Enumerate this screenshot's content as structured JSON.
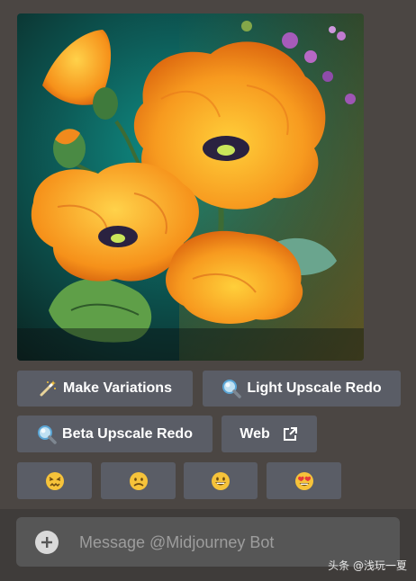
{
  "buttons": {
    "make_variations": "Make Variations",
    "light_upscale_redo": "Light Upscale Redo",
    "beta_upscale_redo": "Beta Upscale Redo",
    "web": "Web"
  },
  "reactions": [
    {
      "icon": "confounded-face-icon"
    },
    {
      "icon": "slightly-frowning-face-icon"
    },
    {
      "icon": "grinning-face-icon"
    },
    {
      "icon": "heart-eyes-face-icon"
    }
  ],
  "composer": {
    "placeholder": "Message @Midjourney Bot"
  },
  "watermark": "头条 @浅玩一夏",
  "colors": {
    "background": "#4b4643",
    "button": "#5a5d66",
    "composer": "#565656",
    "emoji_yellow": "#f6c33a"
  }
}
